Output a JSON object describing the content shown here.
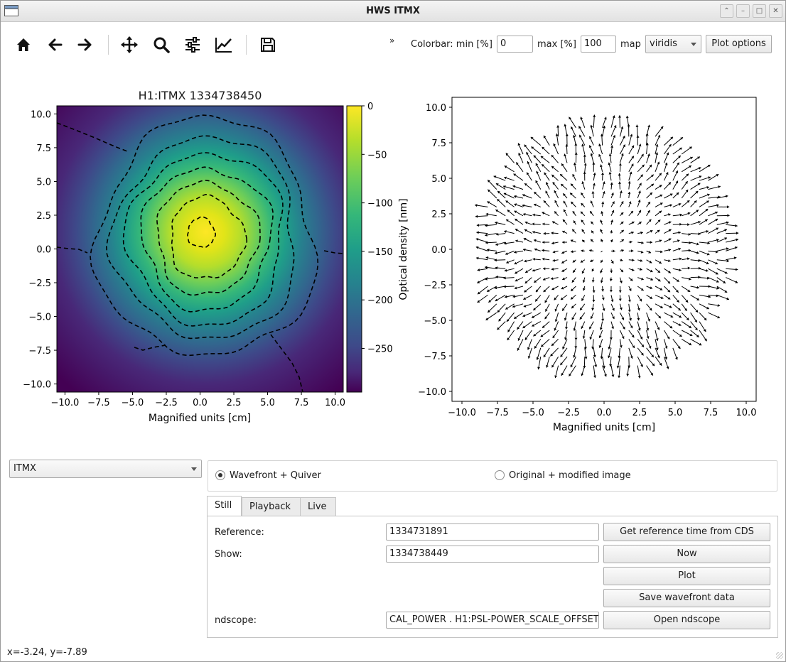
{
  "window": {
    "title": "HWS ITMX"
  },
  "toolbar": {
    "icons": [
      "home-icon",
      "back-icon",
      "forward-icon",
      "pan-icon",
      "zoom-icon",
      "configure-subplots-icon",
      "edit-axis-icon",
      "save-icon"
    ],
    "overflow": "»",
    "colorbar_label": "Colorbar: min [%]",
    "min_value": "0",
    "max_label": "max [%]",
    "max_value": "100",
    "map_label": "map",
    "map_value": "viridis",
    "plot_options": "Plot options"
  },
  "left_plot": {
    "title": "H1:ITMX 1334738450",
    "xlabel": "Magnified units [cm]",
    "x_ticks": [
      "−10.0",
      "−7.5",
      "−5.0",
      "−2.5",
      "0.0",
      "2.5",
      "5.0",
      "7.5",
      "10.0"
    ],
    "y_ticks": [
      "10.0",
      "7.5",
      "5.0",
      "2.5",
      "0.0",
      "−2.5",
      "−5.0",
      "−7.5",
      "−10.0"
    ],
    "colorbar_label": "Optical density [nm]",
    "colorbar_ticks": [
      "0",
      "−50",
      "−100",
      "−150",
      "−200",
      "−250"
    ]
  },
  "right_plot": {
    "xlabel": "Magnified units [cm]",
    "x_ticks": [
      "−10.0",
      "−7.5",
      "−5.0",
      "−2.5",
      "0.0",
      "2.5",
      "5.0",
      "7.5",
      "10.0"
    ],
    "y_ticks": [
      "10.0",
      "7.5",
      "5.0",
      "2.5",
      "0.0",
      "−2.5",
      "−5.0",
      "−7.5",
      "−10.0"
    ]
  },
  "chart_data": [
    {
      "type": "heatmap",
      "title": "H1:ITMX 1334738450",
      "xlabel": "Magnified units [cm]",
      "ylabel": "",
      "xlim": [
        -10.6,
        10.6
      ],
      "ylim": [
        -10.6,
        10.6
      ],
      "colormap": "viridis",
      "colorbar": {
        "label": "Optical density [nm]",
        "range": [
          -295,
          0
        ]
      },
      "peak_center": [
        0.5,
        1.2
      ],
      "contour_levels": [
        -20,
        -60,
        -100,
        -140,
        -180,
        -220,
        -260
      ]
    },
    {
      "type": "scatter",
      "subtype": "quiver",
      "xlabel": "Magnified units [cm]",
      "ylabel": "",
      "xlim": [
        -10.7,
        10.7
      ],
      "ylim": [
        -10.7,
        10.7
      ],
      "aperture_radius": 8.8,
      "vector_direction": "radial-outward"
    }
  ],
  "selector": {
    "value": "ITMX"
  },
  "mode": {
    "option1": "Wavefront + Quiver",
    "option2": "Original + modified image",
    "selected": "Wavefront + Quiver"
  },
  "tabs": [
    "Still",
    "Playback",
    "Live"
  ],
  "still": {
    "reference_label": "Reference:",
    "reference_value": "1334731891",
    "show_label": "Show:",
    "show_value": "1334738449",
    "ndscope_label": "ndscope:",
    "ndscope_value": "CAL_POWER . H1:PSL-POWER_SCALE_OFFSET",
    "btn_get_ref": "Get reference time from CDS",
    "btn_now": "Now",
    "btn_plot": "Plot",
    "btn_save": "Save wavefront data",
    "btn_ndscope": "Open ndscope"
  },
  "status": "x=-3.24, y=-7.89",
  "colors": {
    "accent": "#440154",
    "peak": "#fde725"
  }
}
